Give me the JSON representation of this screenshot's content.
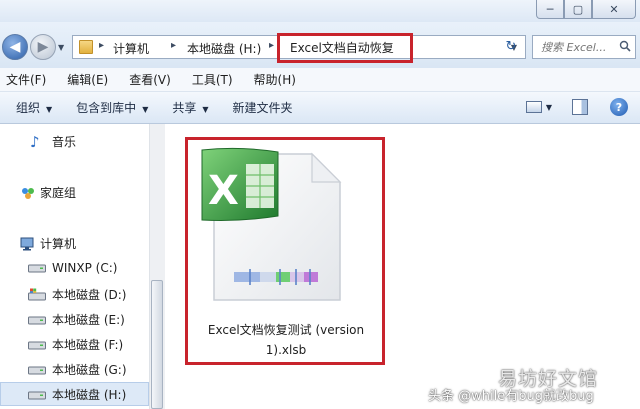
{
  "window_buttons": [
    "─",
    "▢",
    "✕"
  ],
  "address": {
    "crumbs": [
      "计算机",
      "本地磁盘 (H:)",
      "Excel文档自动恢复"
    ],
    "separator": "▸",
    "refresh": "↻"
  },
  "search": {
    "placeholder": "搜索 Excel..."
  },
  "menu": [
    "文件(F)",
    "编辑(E)",
    "查看(V)",
    "工具(T)",
    "帮助(H)"
  ],
  "commands": {
    "organize": "组织",
    "include_library": "包含到库中",
    "share": "共享",
    "new_folder": "新建文件夹",
    "help": "?"
  },
  "sidebar": {
    "music": "音乐",
    "homegroup": "家庭组",
    "computer": "计算机",
    "drives": [
      "WINXP (C:)",
      "本地磁盘 (D:)",
      "本地磁盘 (E:)",
      "本地磁盘 (F:)",
      "本地磁盘 (G:)",
      "本地磁盘 (H:)"
    ]
  },
  "file": {
    "name_line1": "Excel文档恢复测试 (version",
    "name_line2": "1).xlsb",
    "icon": "excel-binary-workbook-icon"
  },
  "watermark": {
    "small": "头条 @while有bug就改bug",
    "big": "易坊好文馆"
  },
  "colors": {
    "highlight_border": "#c8232c",
    "excel_green": "#2e8b3a",
    "selection": "#dde9f7"
  }
}
